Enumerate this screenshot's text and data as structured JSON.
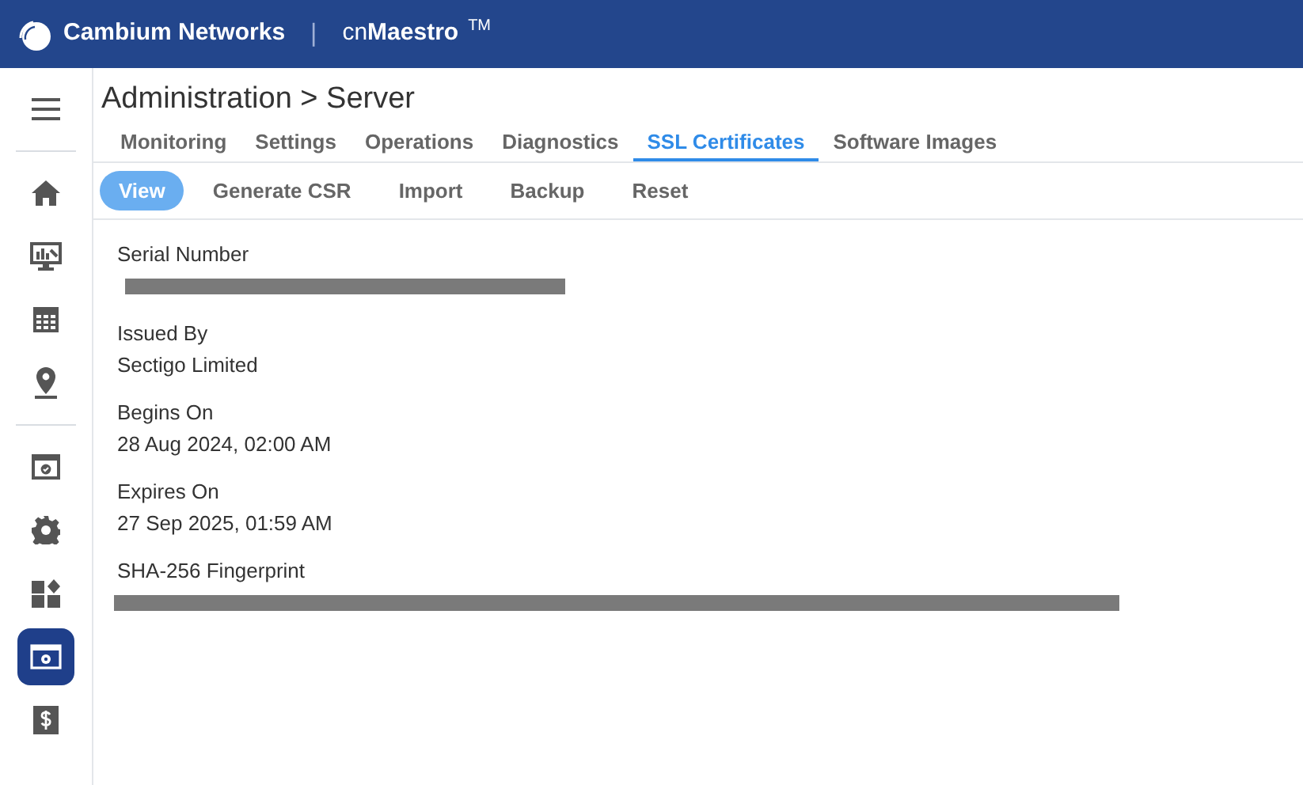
{
  "header": {
    "brand": "Cambium Networks",
    "separator": "|",
    "product_prefix": "cn",
    "product": "Maestro",
    "trademark": "TM"
  },
  "sidebar": {
    "items": [
      {
        "kind": "menu",
        "selected": false
      },
      {
        "kind": "divider"
      },
      {
        "kind": "home",
        "selected": false
      },
      {
        "kind": "monitor",
        "selected": false
      },
      {
        "kind": "table",
        "selected": false
      },
      {
        "kind": "pin",
        "selected": false
      },
      {
        "kind": "divider"
      },
      {
        "kind": "browser",
        "selected": false
      },
      {
        "kind": "gear",
        "selected": false
      },
      {
        "kind": "widgets",
        "selected": false
      },
      {
        "kind": "admin",
        "selected": true
      },
      {
        "kind": "dollar",
        "selected": false
      }
    ]
  },
  "breadcrumb": "Administration > Server",
  "tabs": [
    {
      "label": "Monitoring",
      "selected": false
    },
    {
      "label": "Settings",
      "selected": false
    },
    {
      "label": "Operations",
      "selected": false
    },
    {
      "label": "Diagnostics",
      "selected": false
    },
    {
      "label": "SSL Certificates",
      "selected": true
    },
    {
      "label": "Software Images",
      "selected": false
    }
  ],
  "subtabs": [
    {
      "label": "View",
      "selected": true
    },
    {
      "label": "Generate CSR",
      "selected": false
    },
    {
      "label": "Import",
      "selected": false
    },
    {
      "label": "Backup",
      "selected": false
    },
    {
      "label": "Reset",
      "selected": false
    }
  ],
  "fields": [
    {
      "label": "Serial Number",
      "kind": "redacted",
      "wide": false
    },
    {
      "label": "Issued By",
      "kind": "text",
      "value": "Sectigo Limited"
    },
    {
      "label": "Begins On",
      "kind": "text",
      "value": "28 Aug 2024, 02:00 AM"
    },
    {
      "label": "Expires On",
      "kind": "text",
      "value": "27 Sep 2025, 01:59 AM"
    },
    {
      "label": "SHA-256 Fingerprint",
      "kind": "redacted",
      "wide": true
    }
  ]
}
